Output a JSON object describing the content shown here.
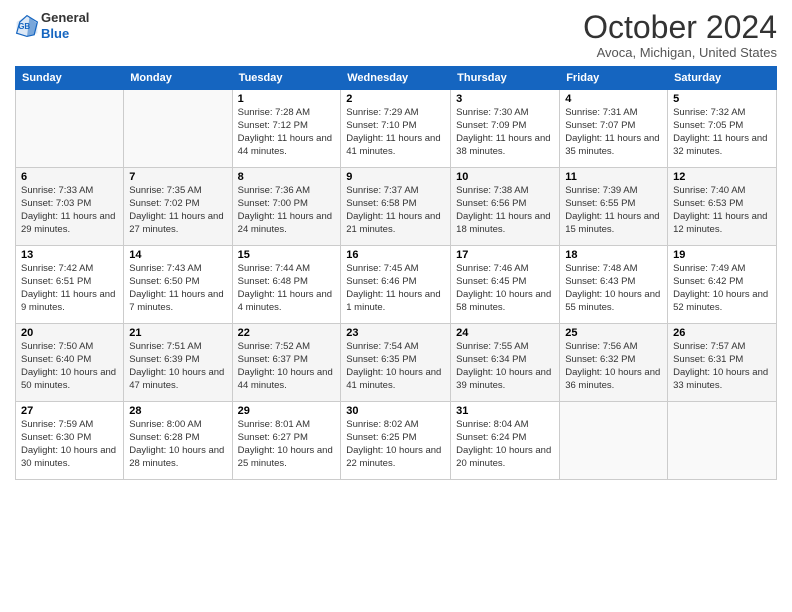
{
  "logo": {
    "general": "General",
    "blue": "Blue"
  },
  "header": {
    "month": "October 2024",
    "location": "Avoca, Michigan, United States"
  },
  "days_of_week": [
    "Sunday",
    "Monday",
    "Tuesday",
    "Wednesday",
    "Thursday",
    "Friday",
    "Saturday"
  ],
  "weeks": [
    [
      {
        "day": "",
        "info": ""
      },
      {
        "day": "",
        "info": ""
      },
      {
        "day": "1",
        "info": "Sunrise: 7:28 AM\nSunset: 7:12 PM\nDaylight: 11 hours and 44 minutes."
      },
      {
        "day": "2",
        "info": "Sunrise: 7:29 AM\nSunset: 7:10 PM\nDaylight: 11 hours and 41 minutes."
      },
      {
        "day": "3",
        "info": "Sunrise: 7:30 AM\nSunset: 7:09 PM\nDaylight: 11 hours and 38 minutes."
      },
      {
        "day": "4",
        "info": "Sunrise: 7:31 AM\nSunset: 7:07 PM\nDaylight: 11 hours and 35 minutes."
      },
      {
        "day": "5",
        "info": "Sunrise: 7:32 AM\nSunset: 7:05 PM\nDaylight: 11 hours and 32 minutes."
      }
    ],
    [
      {
        "day": "6",
        "info": "Sunrise: 7:33 AM\nSunset: 7:03 PM\nDaylight: 11 hours and 29 minutes."
      },
      {
        "day": "7",
        "info": "Sunrise: 7:35 AM\nSunset: 7:02 PM\nDaylight: 11 hours and 27 minutes."
      },
      {
        "day": "8",
        "info": "Sunrise: 7:36 AM\nSunset: 7:00 PM\nDaylight: 11 hours and 24 minutes."
      },
      {
        "day": "9",
        "info": "Sunrise: 7:37 AM\nSunset: 6:58 PM\nDaylight: 11 hours and 21 minutes."
      },
      {
        "day": "10",
        "info": "Sunrise: 7:38 AM\nSunset: 6:56 PM\nDaylight: 11 hours and 18 minutes."
      },
      {
        "day": "11",
        "info": "Sunrise: 7:39 AM\nSunset: 6:55 PM\nDaylight: 11 hours and 15 minutes."
      },
      {
        "day": "12",
        "info": "Sunrise: 7:40 AM\nSunset: 6:53 PM\nDaylight: 11 hours and 12 minutes."
      }
    ],
    [
      {
        "day": "13",
        "info": "Sunrise: 7:42 AM\nSunset: 6:51 PM\nDaylight: 11 hours and 9 minutes."
      },
      {
        "day": "14",
        "info": "Sunrise: 7:43 AM\nSunset: 6:50 PM\nDaylight: 11 hours and 7 minutes."
      },
      {
        "day": "15",
        "info": "Sunrise: 7:44 AM\nSunset: 6:48 PM\nDaylight: 11 hours and 4 minutes."
      },
      {
        "day": "16",
        "info": "Sunrise: 7:45 AM\nSunset: 6:46 PM\nDaylight: 11 hours and 1 minute."
      },
      {
        "day": "17",
        "info": "Sunrise: 7:46 AM\nSunset: 6:45 PM\nDaylight: 10 hours and 58 minutes."
      },
      {
        "day": "18",
        "info": "Sunrise: 7:48 AM\nSunset: 6:43 PM\nDaylight: 10 hours and 55 minutes."
      },
      {
        "day": "19",
        "info": "Sunrise: 7:49 AM\nSunset: 6:42 PM\nDaylight: 10 hours and 52 minutes."
      }
    ],
    [
      {
        "day": "20",
        "info": "Sunrise: 7:50 AM\nSunset: 6:40 PM\nDaylight: 10 hours and 50 minutes."
      },
      {
        "day": "21",
        "info": "Sunrise: 7:51 AM\nSunset: 6:39 PM\nDaylight: 10 hours and 47 minutes."
      },
      {
        "day": "22",
        "info": "Sunrise: 7:52 AM\nSunset: 6:37 PM\nDaylight: 10 hours and 44 minutes."
      },
      {
        "day": "23",
        "info": "Sunrise: 7:54 AM\nSunset: 6:35 PM\nDaylight: 10 hours and 41 minutes."
      },
      {
        "day": "24",
        "info": "Sunrise: 7:55 AM\nSunset: 6:34 PM\nDaylight: 10 hours and 39 minutes."
      },
      {
        "day": "25",
        "info": "Sunrise: 7:56 AM\nSunset: 6:32 PM\nDaylight: 10 hours and 36 minutes."
      },
      {
        "day": "26",
        "info": "Sunrise: 7:57 AM\nSunset: 6:31 PM\nDaylight: 10 hours and 33 minutes."
      }
    ],
    [
      {
        "day": "27",
        "info": "Sunrise: 7:59 AM\nSunset: 6:30 PM\nDaylight: 10 hours and 30 minutes."
      },
      {
        "day": "28",
        "info": "Sunrise: 8:00 AM\nSunset: 6:28 PM\nDaylight: 10 hours and 28 minutes."
      },
      {
        "day": "29",
        "info": "Sunrise: 8:01 AM\nSunset: 6:27 PM\nDaylight: 10 hours and 25 minutes."
      },
      {
        "day": "30",
        "info": "Sunrise: 8:02 AM\nSunset: 6:25 PM\nDaylight: 10 hours and 22 minutes."
      },
      {
        "day": "31",
        "info": "Sunrise: 8:04 AM\nSunset: 6:24 PM\nDaylight: 10 hours and 20 minutes."
      },
      {
        "day": "",
        "info": ""
      },
      {
        "day": "",
        "info": ""
      }
    ]
  ]
}
